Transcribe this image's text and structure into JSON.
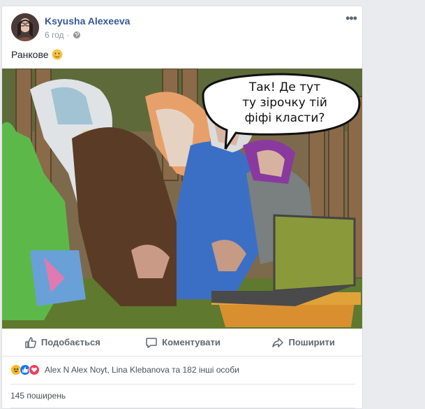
{
  "post": {
    "author": "Ksyusha Alexeeva",
    "time": "6 год",
    "caption": "Ранкове",
    "caption_emoji": "smiling-face-icon",
    "image": {
      "speech_bubble_lines": [
        "Так! Де тут",
        "ту зірочку тій",
        "фіфі класти?"
      ]
    },
    "actions": {
      "like_label": "Подобається",
      "comment_label": "Коментувати",
      "share_label": "Поширити"
    },
    "reactions": {
      "types": [
        "haha",
        "like",
        "love"
      ],
      "text": "Alex N Alex Noyt, Lina Klebanova та 182 інші особи"
    },
    "shares_text": "145 поширень"
  },
  "colors": {
    "link": "#365899",
    "muted": "#90949c",
    "action": "#606770",
    "background": "#e9ebee",
    "like_blue": "#1877f2",
    "love_red": "#f33e58",
    "haha_yellow": "#f7b928"
  }
}
